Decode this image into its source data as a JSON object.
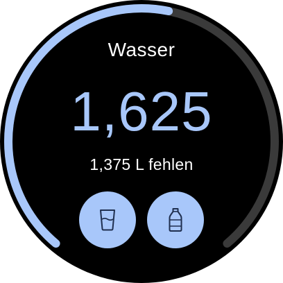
{
  "app": {
    "title": "Wasser",
    "current_value": "1,625",
    "remaining_text": "1,375 L fehlen",
    "progress_fraction": 0.542
  },
  "actions": [
    {
      "icon": "glass-icon"
    },
    {
      "icon": "bottle-icon"
    }
  ],
  "colors": {
    "accent": "#a8c7fa",
    "track": "#3a3a3a",
    "background": "#000000",
    "text": "#ffffff",
    "icon": "#1f2f4f"
  }
}
